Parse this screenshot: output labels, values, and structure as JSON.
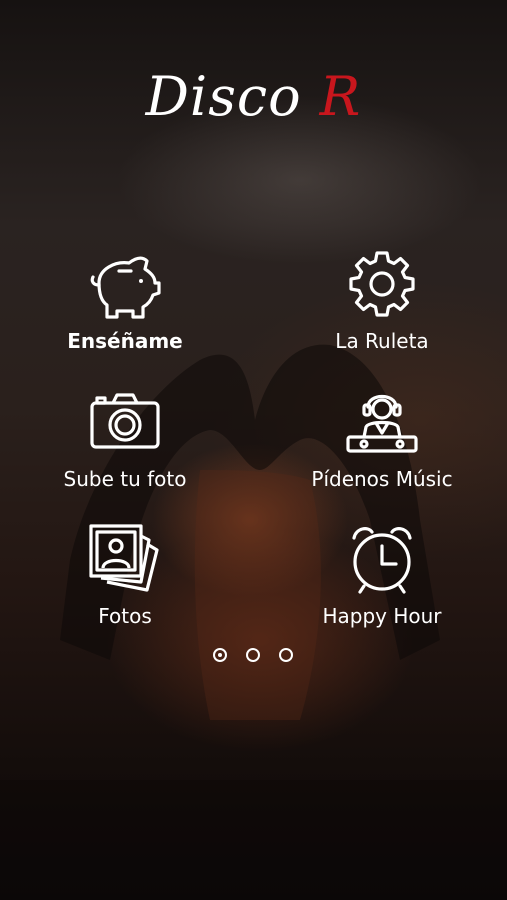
{
  "logo": {
    "word": "Disco",
    "letter": "R",
    "accent_color": "#c8161d"
  },
  "menu": [
    {
      "label": "Enséñame",
      "icon": "piggy-bank-icon"
    },
    {
      "label": "La Ruleta",
      "icon": "gear-icon"
    },
    {
      "label": "Sube tu foto",
      "icon": "camera-icon"
    },
    {
      "label": "Pídenos Músic",
      "icon": "dj-icon"
    },
    {
      "label": "Fotos",
      "icon": "photos-icon"
    },
    {
      "label": "Happy Hour",
      "icon": "alarm-clock-icon"
    }
  ],
  "pagination": {
    "pages": 3,
    "current": 1
  }
}
